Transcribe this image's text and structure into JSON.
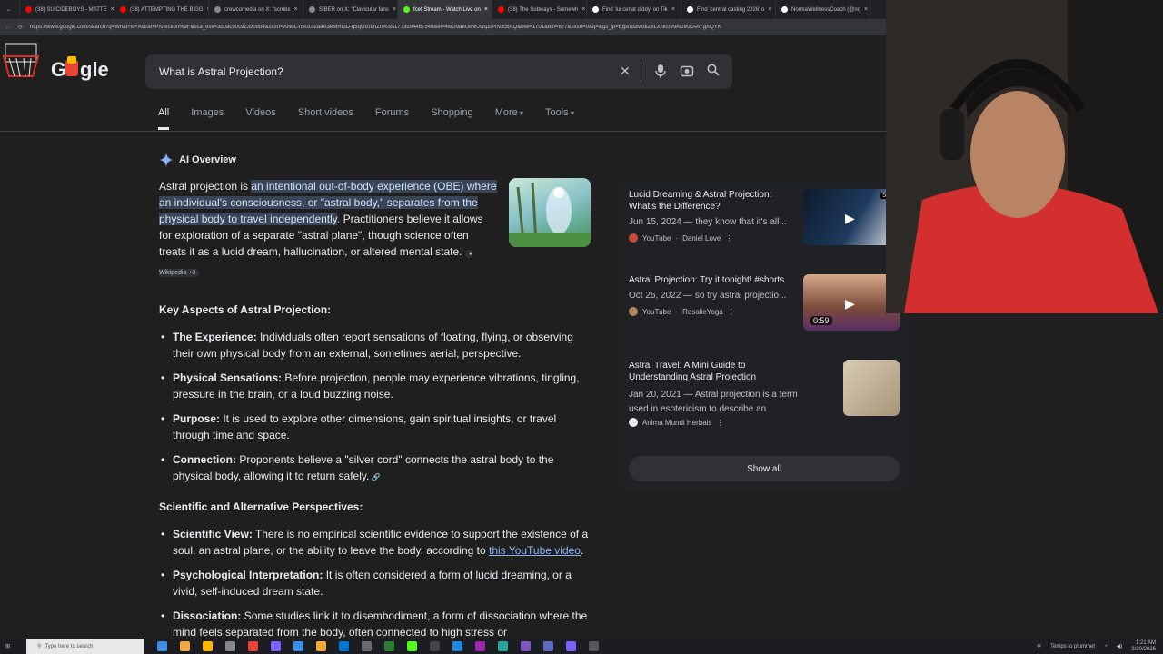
{
  "browser": {
    "tabs": [
      {
        "label": "(38) SUICIDEBOYS - MATTE",
        "color": "#ff0000"
      },
      {
        "label": "(38) ATTEMPTING THE BIGG",
        "color": "#ff0000"
      },
      {
        "label": "crewcomedia on X: \"scrubs",
        "color": "#888888"
      },
      {
        "label": "SIBER on X: \"Clavicular fans",
        "color": "#888888"
      },
      {
        "label": "fcef Stream - Watch Live on",
        "color": "#53fc18",
        "active": true
      },
      {
        "label": "(38) The Subways - Somewh",
        "color": "#ff0000"
      },
      {
        "label": "Find 'lui cenat diddy' on Tik",
        "color": "#ffffff"
      },
      {
        "label": "Find 'central casting 2026' o",
        "color": "#ffffff"
      },
      {
        "label": "NormaWellnessCoach (@no",
        "color": "#ffffff"
      }
    ],
    "url": "https://www.google.com/search?q=What+is+Astral+Projection%3F&sca_esv=3d0ac90c923908b4&sxsrf=ANbL-n501o2aaA3eMRtuD-q5qOlzfbnZ0%3A1773994467548&ei=4wG9aeUwIKXzqtsPiN3c6AQ&biw=1701&bih=877&sxsrf=0&q=&gs_lp=Egxnd3MtdiZ6LXNlcnAiADIKEAAYgAQYK"
  },
  "search": {
    "query": "What is Astral Projection?",
    "logo_text": "G  gle"
  },
  "nav_tabs": [
    "All",
    "Images",
    "Videos",
    "Short videos",
    "Forums",
    "Shopping",
    "More",
    "Tools"
  ],
  "ai_overview": {
    "label": "AI Overview",
    "intro_prefix": "Astral projection is ",
    "intro_highlight": "an intentional out-of-body experience (OBE) where an individual's consciousness, or \"astral body,\" separates from the physical body to travel independently",
    "intro_rest": ". Practitioners believe it allows for exploration of a separate \"astral plane\", though science often treats it as a lucid dream, hallucination, or altered mental state.",
    "citation": "Wikipedia +3",
    "section1_title": "Key Aspects of Astral Projection:",
    "section1_items": [
      {
        "term": "The Experience:",
        "text": " Individuals often report sensations of floating, flying, or observing their own physical body from an external, sometimes aerial, perspective."
      },
      {
        "term": "Physical Sensations:",
        "text": " Before projection, people may experience vibrations, tingling, pressure in the brain, or a loud buzzing noise."
      },
      {
        "term": "Purpose:",
        "text": " It is used to explore other dimensions, gain spiritual insights, or travel through time and space."
      },
      {
        "term": "Connection:",
        "text": " Proponents believe a \"silver cord\" connects the astral body to the physical body, allowing it to return safely."
      }
    ],
    "section2_title": "Scientific and Alternative Perspectives:",
    "sci_term": "Scientific View:",
    "sci_text": " There is no empirical scientific evidence to support the existence of a soul, an astral plane, or the ability to leave the body, according to ",
    "sci_link": "this YouTube video",
    "sci_end": ".",
    "psy_term": "Psychological Interpretation:",
    "psy_text": " It is often considered a form of ",
    "psy_link": "lucid dreaming",
    "psy_end": ", or a vivid, self-induced dream state.",
    "dis_term": "Dissociation:",
    "dis_text": " Some studies link it to disembodiment, a form of dissociation where the mind feels separated from the body, often connected to high stress or"
  },
  "side_panel": {
    "cards": [
      {
        "title": "Lucid Dreaming & Astral Projection: What's the Difference?",
        "meta": "Jun 15, 2024 — they know that it's all...",
        "source": "YouTube",
        "author": "Daniel Love",
        "duration": "5m"
      },
      {
        "title": "Astral Projection: Try it tonight! #shorts",
        "meta": "Oct 26, 2022 — so try astral projectio...",
        "source": "YouTube",
        "author": "RosalieYoga",
        "duration": "0:59"
      },
      {
        "title": "Astral Travel: A Mini Guide to Understanding Astral Projection",
        "meta": "Jan 20, 2021 — Astral projection is a term used in esotericism to describe an intentional out-o...",
        "source": "Anima Mundi Herbals",
        "author": ""
      }
    ],
    "show_all": "Show all"
  },
  "taskbar": {
    "search_placeholder": "Type here to search",
    "weather": "Temps to plummet",
    "time": "1:21 AM",
    "date": "3/20/2026"
  }
}
